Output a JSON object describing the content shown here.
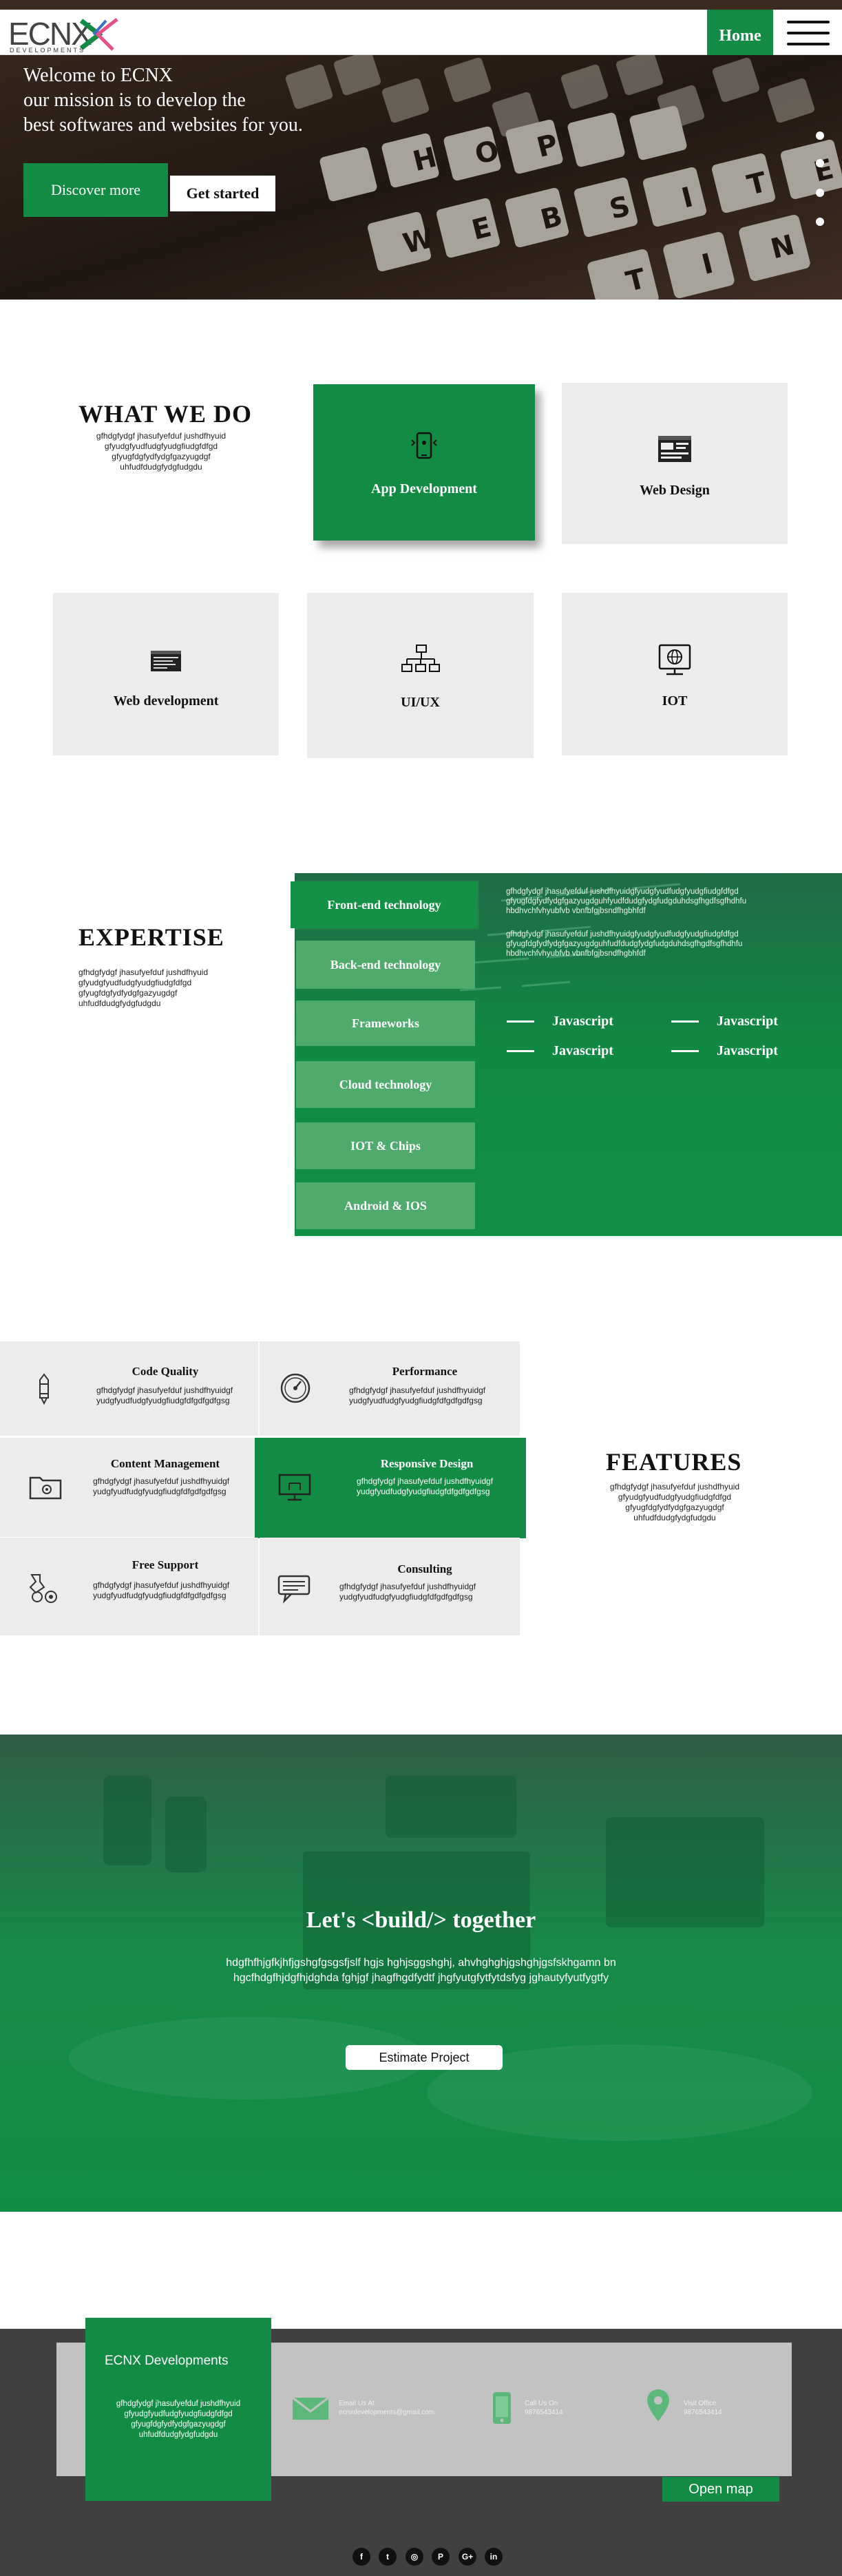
{
  "header": {
    "logo_text": "ECNX",
    "logo_sub": "DEVELOPMENTS",
    "home_label": "Home"
  },
  "hero": {
    "line1": "Welcome to ECNX",
    "line2": "our mission is to develop the",
    "line3": "best softwares and websites for you.",
    "discover_label": "Discover more",
    "started_label": "Get started",
    "slide_count": 4
  },
  "what_we_do": {
    "title": "WHAT WE DO",
    "desc": [
      "gfhdgfydgf jhasufyefduf jushdfhyuid",
      "gfyudgfyudfudgfyudgfiudgfdfgd",
      "gfyugfdgfydfydgfgazyugdgf",
      "uhfudfdudgfydgfudgdu"
    ],
    "cards": [
      {
        "label": "App Development",
        "icon": "mobile-app-icon"
      },
      {
        "label": "Web Design",
        "icon": "web-design-icon"
      },
      {
        "label": "Web development",
        "icon": "web-development-icon"
      },
      {
        "label": "UI/UX",
        "icon": "sitemap-icon"
      },
      {
        "label": "IOT",
        "icon": "iot-globe-icon"
      }
    ]
  },
  "expertise": {
    "title": "EXPERTISE",
    "desc": [
      "gfhdgfydgf jhasufyefduf jushdfhyuid",
      "gfyudgfyudfudgfyudgfiudgfdfgd",
      "gfyugfdgfydfydgfgazyugdgf",
      "uhfudfdudgfydgfudgdu"
    ],
    "tabs": [
      "Front-end technology",
      "Back-end technology",
      "Frameworks",
      "Cloud technology",
      "IOT & Chips",
      "Android & IOS"
    ],
    "text_block_1": "gfhdgfydgf jhasufyefduf jushdfhyuidgfyudgfyudfudgfyudgfiudgfdfgd gfyugfdgfydfydgfgazyugdguhfyudfdudgfydgfudgduhdsgfhgdfsgfhdhfu hbdhvchfvhyubfvb vbnfbfgjbsndfhgbhfdf",
    "text_block_2": "gfhdgfydgf jhasufyefduf jushdfhyuidgfyudgfyudfudgfyudgfiudgfdfgd gfyugfdgfydfydgfgazyugdguhfudfdudgfydgfudgduhdsgfhgdfsgfhdhfu hbdhvchfvhyubfvb vbnfbfgjbsndfhgbhfdf",
    "items": [
      "Javascript",
      "Javascript",
      "Javascript",
      "Javascript"
    ]
  },
  "features": {
    "title": "FEATURES",
    "desc": [
      "gfhdgfydgf jhasufyefduf jushdfhyuid",
      "gfyudgfyudfudgfyudgfiudgfdfgd",
      "gfyugfdgfydfydgfgazyugdgf",
      "uhfudfdudgfydgfudgdu"
    ],
    "item_desc_1": "gfhdgfydgf jhasufyefduf jushdfhyuidgf",
    "item_desc_2": "yudgfyudfudgfyudgfiudgfdfgdfgdfgsg",
    "items": [
      {
        "title": "Code Quality",
        "icon": "pencil-icon"
      },
      {
        "title": "Performance",
        "icon": "speedometer-icon"
      },
      {
        "title": "Content Management",
        "icon": "folder-icon"
      },
      {
        "title": "Responsive Design",
        "icon": "monitor-icon"
      },
      {
        "title": "Free Support",
        "icon": "support-gears-icon"
      },
      {
        "title": "Consulting",
        "icon": "chat-bubble-icon"
      }
    ]
  },
  "build": {
    "title": "Let's <build/> together",
    "line1": "hdgfhfhjgfkjhfjgshgfgsgsfjslf hgjs hghjsggshghj, ahvhghghjgshghjgsfskhgamn bn",
    "line2": "hgcfhdgfhjdgfhjdghda  fghjgf jhagfhgdfydtf jhgfyutgfytfytdsfyg jghautyfyutfygtfy",
    "estimate_label": "Estimate Project"
  },
  "footer": {
    "company": "ECNX Developments",
    "desc": [
      "gfhdgfydgf jhasufyefduf jushdfhyuid",
      "gfyudgfyudfudgfyudgfiudgfdfgd",
      "gfyugfdgfydfydgfgazyugdgf",
      "uhfudfdudgfydgfudgdu"
    ],
    "email_label": "Email Us At",
    "email_value": "ecnxdevelopments@gmail.com",
    "call_label": "Call Us On",
    "call_value": "9876543414",
    "visit_label": "Visit Office",
    "visit_value": "9876543414",
    "open_map_label": "Open map",
    "social": [
      {
        "glyph": "f",
        "icon": "facebook-icon"
      },
      {
        "glyph": "t",
        "icon": "twitter-icon"
      },
      {
        "glyph": "◎",
        "icon": "instagram-icon"
      },
      {
        "glyph": "P",
        "icon": "pinterest-icon"
      },
      {
        "glyph": "G+",
        "icon": "google-plus-icon"
      },
      {
        "glyph": "in",
        "icon": "linkedin-icon"
      }
    ]
  },
  "colors": {
    "brand_green": "#128b45",
    "card_gray": "#ececec",
    "footer_dark": "#404040",
    "footer_band": "#c2c2c2"
  }
}
